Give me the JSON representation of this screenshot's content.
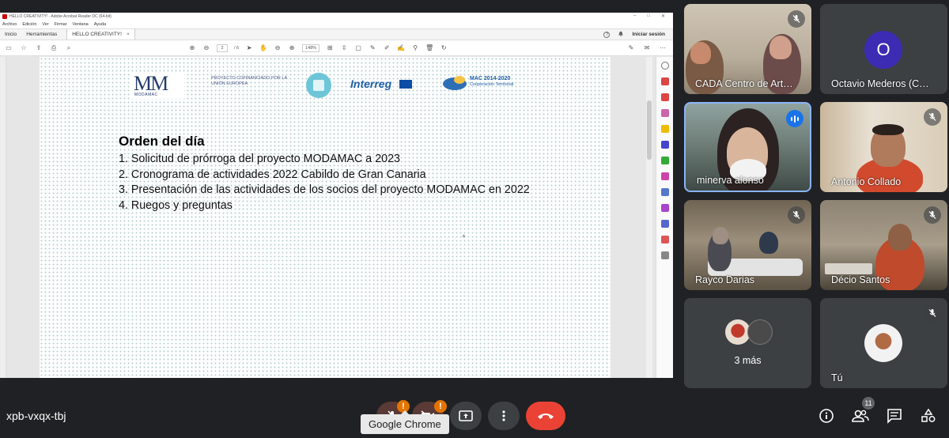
{
  "acrobat": {
    "window_title": "HELLO CREATIVITY! - Adobe Acrobat Reader DC (64-bit)",
    "menu": [
      "Archivo",
      "Edición",
      "Ver",
      "Firmar",
      "Ventana",
      "Ayuda"
    ],
    "tabs": {
      "home": "Inicio",
      "tools": "Herramientas",
      "doc": "HELLO CREATIVITY!",
      "close": "×"
    },
    "help": "?",
    "login": "Iniciar sesión",
    "page_current": "2",
    "page_total": "/ 6",
    "zoom": "148%"
  },
  "document": {
    "logo_mm": "MM",
    "logo_mm_sub": "MODAMAC",
    "logo_project": "PROYECTO COFINANCIADO POR LA UNIÓN EUROPEA",
    "logo_interreg": "Interreg",
    "logo_mac": "MAC 2014-2020",
    "logo_mac_sub": "Cooperación Territorial",
    "title": "Orden del día",
    "agenda": [
      "1. Solicitud de prórroga del proyecto MODAMAC a 2023",
      "2. Cronograma de actividades 2022 Cabildo de Gran Canaria",
      "3. Presentación de las actividades de los socios del proyecto MODAMAC en 2022",
      "4. Ruegos y preguntas"
    ]
  },
  "participants": {
    "cada": "CADA Centro de Art…",
    "octavio": "Octavio Mederos (C…",
    "octavio_initial": "O",
    "minerva": "minerva alonso",
    "antonio": "Antonio Collado",
    "rayco": "Rayco Darias",
    "decio": "Décio Santos",
    "more": "3 más",
    "me": "Tú"
  },
  "meet": {
    "code": "xpb-vxqx-tbj",
    "tooltip": "Google Chrome",
    "people_count": "11",
    "warn": "!"
  },
  "colors": {
    "meet_bg": "#202124",
    "tile_bg": "#3c4043",
    "end_call": "#ea4335",
    "active_border": "#8ab4f8",
    "speaking": "#1a73e8"
  }
}
